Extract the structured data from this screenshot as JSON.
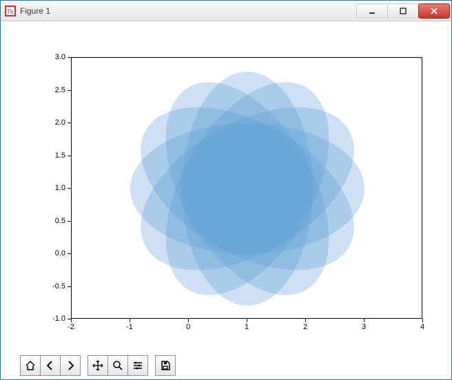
{
  "window": {
    "title": "Figure 1"
  },
  "colors": {
    "ellipse_fill": "#5b9bd5"
  },
  "chart_data": {
    "type": "ellipses",
    "xlim": [
      -2,
      4
    ],
    "ylim": [
      -1,
      3
    ],
    "xticks": [
      -2,
      -1,
      0,
      1,
      2,
      3,
      4
    ],
    "yticks": [
      -1.0,
      -0.5,
      0.0,
      0.5,
      1.0,
      1.5,
      2.0,
      2.5,
      3.0
    ],
    "ellipses": [
      {
        "cx": 1,
        "cy": 1,
        "width": 4,
        "height": 2,
        "angle": 0,
        "alpha": 0.3
      },
      {
        "cx": 1,
        "cy": 1,
        "width": 4,
        "height": 2,
        "angle": 30,
        "alpha": 0.3
      },
      {
        "cx": 1,
        "cy": 1,
        "width": 4,
        "height": 2,
        "angle": 60,
        "alpha": 0.3
      },
      {
        "cx": 1,
        "cy": 1,
        "width": 4,
        "height": 2,
        "angle": 90,
        "alpha": 0.3
      },
      {
        "cx": 1,
        "cy": 1,
        "width": 4,
        "height": 2,
        "angle": 120,
        "alpha": 0.3
      },
      {
        "cx": 1,
        "cy": 1,
        "width": 4,
        "height": 2,
        "angle": 150,
        "alpha": 0.3
      }
    ],
    "title": "",
    "xlabel": "",
    "ylabel": ""
  }
}
